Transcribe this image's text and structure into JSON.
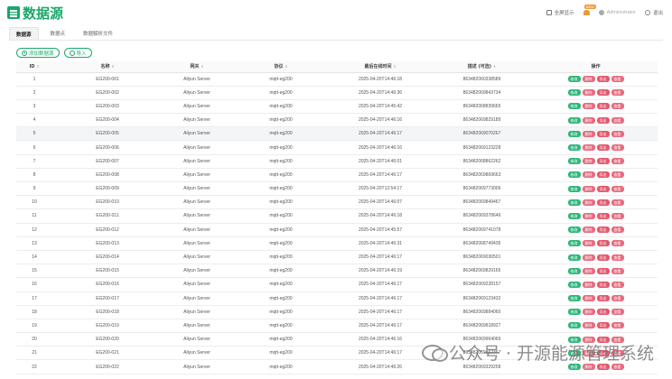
{
  "app": {
    "title": "数据源"
  },
  "header": {
    "fullscreen_label": "全屏显示",
    "notification_badge": "NEW",
    "user_name": "Administrator",
    "logout_label": "退出"
  },
  "tabs": [
    {
      "label": "数据源",
      "active": true
    },
    {
      "label": "数据点",
      "active": false
    },
    {
      "label": "数据解析文件",
      "active": false
    }
  ],
  "toolbar": {
    "add_label": "添加数据源",
    "import_label": "导入"
  },
  "table": {
    "columns": [
      "ID",
      "名称",
      "网关",
      "协议",
      "最后在线时间",
      "描述 (可选)",
      "操作"
    ],
    "actions": [
      "修改",
      "删除",
      "导出",
      "查看"
    ],
    "rows": [
      {
        "id": "1",
        "name": "EG200-001",
        "gateway": "Aliyun Server",
        "protocol": "mqtt-eg200",
        "last_online": "2025-04-20T14:46:18",
        "desc": "863482060338589"
      },
      {
        "id": "2",
        "name": "EG200-002",
        "gateway": "Aliyun Server",
        "protocol": "mqtt-eg200",
        "last_online": "2025-04-20T14:46:36",
        "desc": "863482069843734"
      },
      {
        "id": "3",
        "name": "EG200-003",
        "gateway": "Aliyun Server",
        "protocol": "mqtt-eg200",
        "last_online": "2025-04-20T14:45:42",
        "desc": "863482068839665"
      },
      {
        "id": "4",
        "name": "EG200-004",
        "gateway": "Aliyun Server",
        "protocol": "mqtt-eg200",
        "last_online": "2025-04-20T14:46:16",
        "desc": "863482069829189"
      },
      {
        "id": "5",
        "name": "EG200-005",
        "gateway": "Aliyun Server",
        "protocol": "mqtt-eg200",
        "last_online": "2025-04-20T14:46:17",
        "desc": "863482069070267"
      },
      {
        "id": "6",
        "name": "EG200-006",
        "gateway": "Aliyun Server",
        "protocol": "mqtt-eg200",
        "last_online": "2025-04-20T14:46:16",
        "desc": "863482069123228"
      },
      {
        "id": "7",
        "name": "EG200-007",
        "gateway": "Aliyun Server",
        "protocol": "mqtt-eg200",
        "last_online": "2025-04-20T14:46:01",
        "desc": "863482068862262"
      },
      {
        "id": "8",
        "name": "EG200-008",
        "gateway": "Aliyun Server",
        "protocol": "mqtt-eg200",
        "last_online": "2025-04-20T14:46:17",
        "desc": "863482069869663"
      },
      {
        "id": "9",
        "name": "EG200-009",
        "gateway": "Aliyun Server",
        "protocol": "mqtt-eg200",
        "last_online": "2025-04-20T12:54:17",
        "desc": "863482069773006"
      },
      {
        "id": "10",
        "name": "EG200-010",
        "gateway": "Aliyun Server",
        "protocol": "mqtt-eg200",
        "last_online": "2025-04-20T14:46:07",
        "desc": "863482069849467"
      },
      {
        "id": "11",
        "name": "EG200-011",
        "gateway": "Aliyun Server",
        "protocol": "mqtt-eg200",
        "last_online": "2025-04-20T14:46:18",
        "desc": "863482069378646"
      },
      {
        "id": "12",
        "name": "EG200-012",
        "gateway": "Aliyun Server",
        "protocol": "mqtt-eg200",
        "last_online": "2025-04-20T14:45:57",
        "desc": "863482069741078"
      },
      {
        "id": "13",
        "name": "EG200-013",
        "gateway": "Aliyun Server",
        "protocol": "mqtt-eg200",
        "last_online": "2025-04-20T14:46:31",
        "desc": "863482068749436"
      },
      {
        "id": "14",
        "name": "EG200-014",
        "gateway": "Aliyun Server",
        "protocol": "mqtt-eg200",
        "last_online": "2025-04-20T14:46:17",
        "desc": "863482069030501"
      },
      {
        "id": "15",
        "name": "EG200-015",
        "gateway": "Aliyun Server",
        "protocol": "mqtt-eg200",
        "last_online": "2025-04-20T14:46:19",
        "desc": "863482069829165"
      },
      {
        "id": "16",
        "name": "EG200-016",
        "gateway": "Aliyun Server",
        "protocol": "mqtt-eg200",
        "last_online": "2025-04-20T14:46:17",
        "desc": "863482069228157"
      },
      {
        "id": "17",
        "name": "EG200-017",
        "gateway": "Aliyun Server",
        "protocol": "mqtt-eg200",
        "last_online": "2025-04-20T14:46:17",
        "desc": "863482069123432"
      },
      {
        "id": "18",
        "name": "EG200-018",
        "gateway": "Aliyun Server",
        "protocol": "mqtt-eg200",
        "last_online": "2025-04-20T14:46:17",
        "desc": "863482069884060"
      },
      {
        "id": "19",
        "name": "EG200-019",
        "gateway": "Aliyun Server",
        "protocol": "mqtt-eg200",
        "last_online": "2025-04-20T14:46:17",
        "desc": "863482069818927"
      },
      {
        "id": "20",
        "name": "EG200-020",
        "gateway": "Aliyun Server",
        "protocol": "mqtt-eg200",
        "last_online": "2025-04-20T14:46:16",
        "desc": "863482069964069"
      },
      {
        "id": "21",
        "name": "EG200-021",
        "gateway": "Aliyun Server",
        "protocol": "mqtt-eg200",
        "last_online": "2025-04-20T14:46:17",
        "desc": "863482069862367"
      },
      {
        "id": "22",
        "name": "EG200-022",
        "gateway": "Aliyun Server",
        "protocol": "mqtt-eg200",
        "last_online": "2025-04-20T14:46:26",
        "desc": "863482069329258"
      }
    ],
    "highlighted_row_index": 4
  },
  "watermark": {
    "text": "公众号 · 开源能源管理系统"
  },
  "colors": {
    "brand": "#1aa86a",
    "edit": "#2fb57b",
    "delete": "#e86a7e",
    "export": "#e2586d",
    "view": "#e86a7e"
  }
}
